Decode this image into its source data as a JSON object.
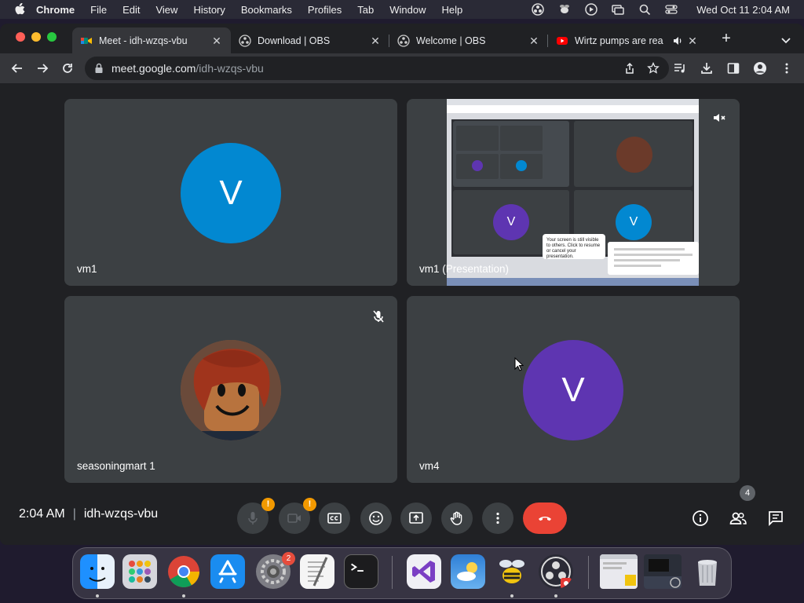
{
  "menubar": {
    "app": "Chrome",
    "items": [
      "File",
      "Edit",
      "View",
      "History",
      "Bookmarks",
      "Profiles",
      "Tab",
      "Window",
      "Help"
    ],
    "clock": "Wed Oct 11  2:04 AM"
  },
  "tabs": [
    {
      "title": "Meet - idh-wzqs-vbu",
      "active": true
    },
    {
      "title": "Download | OBS",
      "active": false
    },
    {
      "title": "Welcome | OBS",
      "active": false
    },
    {
      "title": "Wirtz pumps are rea",
      "active": false
    }
  ],
  "omnibox": {
    "host": "meet.google.com",
    "path": "/idh-wzqs-vbu"
  },
  "tiles": [
    {
      "name": "vm1",
      "avatar_letter": "V",
      "avatar_color": "#0288d1"
    },
    {
      "name": "vm1 (Presentation)"
    },
    {
      "name": "seasoningmart 1"
    },
    {
      "name": "vm4",
      "avatar_letter": "V",
      "avatar_color": "#5e35b1"
    }
  ],
  "presentation": {
    "mini_tile_letters": [
      "V",
      "V"
    ],
    "popup_text": "Your screen is still visible to others. Click to resume or cancel your presentation."
  },
  "bottombar": {
    "time": "2:04 AM",
    "meeting_code": "idh-wzqs-vbu",
    "warn_mark": "!",
    "people_count": "4"
  },
  "dock": {
    "system_settings_badge": "2"
  },
  "colors": {
    "accent_end_call": "#ea4335",
    "warning": "#f29900",
    "tile_bg": "#3c4043"
  }
}
